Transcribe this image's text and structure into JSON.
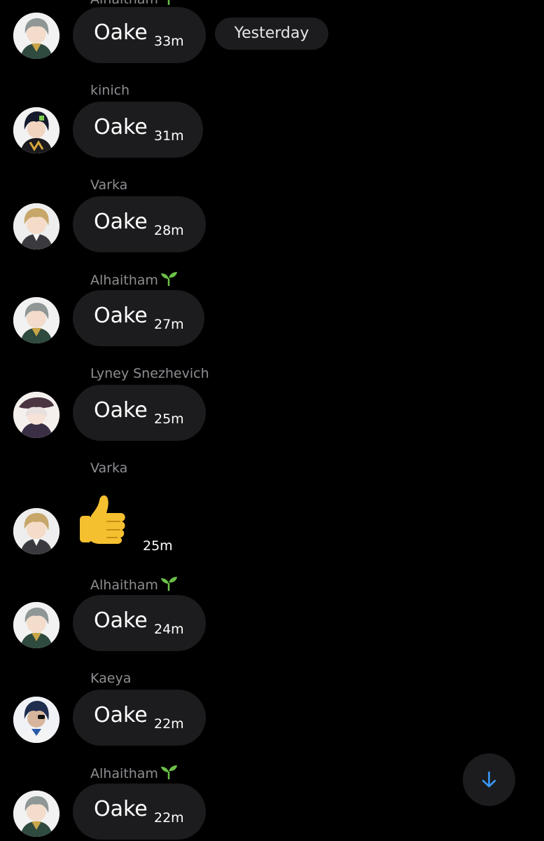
{
  "date_divider": "Yesterday",
  "colors": {
    "background": "#000000",
    "bubble": "#1c1c1e",
    "sender_name": "#8e8e93",
    "accent": "#3a96f5",
    "sprout": "#6cc04a"
  },
  "messages": [
    {
      "sender": "Alhaitham",
      "sprout": true,
      "text": "Oake",
      "time": "33m",
      "avatar": "alhaitham"
    },
    {
      "sender": "kinich",
      "sprout": false,
      "text": "Oake",
      "time": "31m",
      "avatar": "kinich"
    },
    {
      "sender": "Varka",
      "sprout": false,
      "text": "Oake",
      "time": "28m",
      "avatar": "varka"
    },
    {
      "sender": "Alhaitham",
      "sprout": true,
      "text": "Oake",
      "time": "27m",
      "avatar": "alhaitham"
    },
    {
      "sender": "Lyney Snezhevich",
      "sprout": false,
      "text": "Oake",
      "time": "25m",
      "avatar": "lyney"
    },
    {
      "sender": "Varka",
      "sprout": false,
      "emoji": "thumbs-up-emoji",
      "time": "25m",
      "avatar": "varka"
    },
    {
      "sender": "Alhaitham",
      "sprout": true,
      "text": "Oake",
      "time": "24m",
      "avatar": "alhaitham"
    },
    {
      "sender": "Kaeya",
      "sprout": false,
      "text": "Oake",
      "time": "22m",
      "avatar": "kaeya"
    },
    {
      "sender": "Alhaitham",
      "sprout": true,
      "text": "Oake",
      "time": "22m",
      "avatar": "alhaitham"
    }
  ],
  "icons": {
    "scroll_down": "arrow-down-icon"
  }
}
